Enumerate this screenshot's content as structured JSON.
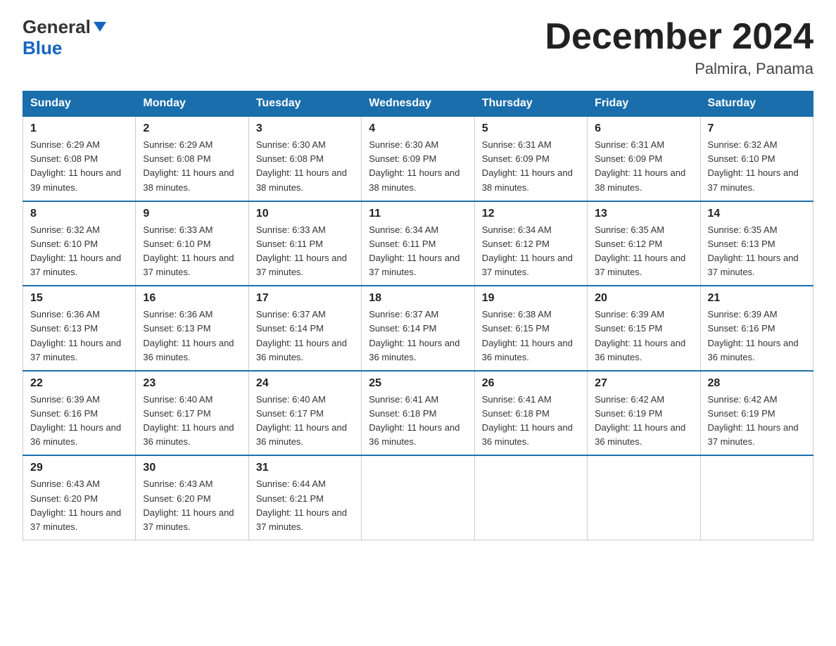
{
  "logo": {
    "line1": "General",
    "line2": "Blue"
  },
  "title": "December 2024",
  "location": "Palmira, Panama",
  "days_of_week": [
    "Sunday",
    "Monday",
    "Tuesday",
    "Wednesday",
    "Thursday",
    "Friday",
    "Saturday"
  ],
  "weeks": [
    [
      {
        "day": "1",
        "sunrise": "6:29 AM",
        "sunset": "6:08 PM",
        "daylight": "11 hours and 39 minutes."
      },
      {
        "day": "2",
        "sunrise": "6:29 AM",
        "sunset": "6:08 PM",
        "daylight": "11 hours and 38 minutes."
      },
      {
        "day": "3",
        "sunrise": "6:30 AM",
        "sunset": "6:08 PM",
        "daylight": "11 hours and 38 minutes."
      },
      {
        "day": "4",
        "sunrise": "6:30 AM",
        "sunset": "6:09 PM",
        "daylight": "11 hours and 38 minutes."
      },
      {
        "day": "5",
        "sunrise": "6:31 AM",
        "sunset": "6:09 PM",
        "daylight": "11 hours and 38 minutes."
      },
      {
        "day": "6",
        "sunrise": "6:31 AM",
        "sunset": "6:09 PM",
        "daylight": "11 hours and 38 minutes."
      },
      {
        "day": "7",
        "sunrise": "6:32 AM",
        "sunset": "6:10 PM",
        "daylight": "11 hours and 37 minutes."
      }
    ],
    [
      {
        "day": "8",
        "sunrise": "6:32 AM",
        "sunset": "6:10 PM",
        "daylight": "11 hours and 37 minutes."
      },
      {
        "day": "9",
        "sunrise": "6:33 AM",
        "sunset": "6:10 PM",
        "daylight": "11 hours and 37 minutes."
      },
      {
        "day": "10",
        "sunrise": "6:33 AM",
        "sunset": "6:11 PM",
        "daylight": "11 hours and 37 minutes."
      },
      {
        "day": "11",
        "sunrise": "6:34 AM",
        "sunset": "6:11 PM",
        "daylight": "11 hours and 37 minutes."
      },
      {
        "day": "12",
        "sunrise": "6:34 AM",
        "sunset": "6:12 PM",
        "daylight": "11 hours and 37 minutes."
      },
      {
        "day": "13",
        "sunrise": "6:35 AM",
        "sunset": "6:12 PM",
        "daylight": "11 hours and 37 minutes."
      },
      {
        "day": "14",
        "sunrise": "6:35 AM",
        "sunset": "6:13 PM",
        "daylight": "11 hours and 37 minutes."
      }
    ],
    [
      {
        "day": "15",
        "sunrise": "6:36 AM",
        "sunset": "6:13 PM",
        "daylight": "11 hours and 37 minutes."
      },
      {
        "day": "16",
        "sunrise": "6:36 AM",
        "sunset": "6:13 PM",
        "daylight": "11 hours and 36 minutes."
      },
      {
        "day": "17",
        "sunrise": "6:37 AM",
        "sunset": "6:14 PM",
        "daylight": "11 hours and 36 minutes."
      },
      {
        "day": "18",
        "sunrise": "6:37 AM",
        "sunset": "6:14 PM",
        "daylight": "11 hours and 36 minutes."
      },
      {
        "day": "19",
        "sunrise": "6:38 AM",
        "sunset": "6:15 PM",
        "daylight": "11 hours and 36 minutes."
      },
      {
        "day": "20",
        "sunrise": "6:39 AM",
        "sunset": "6:15 PM",
        "daylight": "11 hours and 36 minutes."
      },
      {
        "day": "21",
        "sunrise": "6:39 AM",
        "sunset": "6:16 PM",
        "daylight": "11 hours and 36 minutes."
      }
    ],
    [
      {
        "day": "22",
        "sunrise": "6:39 AM",
        "sunset": "6:16 PM",
        "daylight": "11 hours and 36 minutes."
      },
      {
        "day": "23",
        "sunrise": "6:40 AM",
        "sunset": "6:17 PM",
        "daylight": "11 hours and 36 minutes."
      },
      {
        "day": "24",
        "sunrise": "6:40 AM",
        "sunset": "6:17 PM",
        "daylight": "11 hours and 36 minutes."
      },
      {
        "day": "25",
        "sunrise": "6:41 AM",
        "sunset": "6:18 PM",
        "daylight": "11 hours and 36 minutes."
      },
      {
        "day": "26",
        "sunrise": "6:41 AM",
        "sunset": "6:18 PM",
        "daylight": "11 hours and 36 minutes."
      },
      {
        "day": "27",
        "sunrise": "6:42 AM",
        "sunset": "6:19 PM",
        "daylight": "11 hours and 36 minutes."
      },
      {
        "day": "28",
        "sunrise": "6:42 AM",
        "sunset": "6:19 PM",
        "daylight": "11 hours and 37 minutes."
      }
    ],
    [
      {
        "day": "29",
        "sunrise": "6:43 AM",
        "sunset": "6:20 PM",
        "daylight": "11 hours and 37 minutes."
      },
      {
        "day": "30",
        "sunrise": "6:43 AM",
        "sunset": "6:20 PM",
        "daylight": "11 hours and 37 minutes."
      },
      {
        "day": "31",
        "sunrise": "6:44 AM",
        "sunset": "6:21 PM",
        "daylight": "11 hours and 37 minutes."
      },
      null,
      null,
      null,
      null
    ]
  ]
}
